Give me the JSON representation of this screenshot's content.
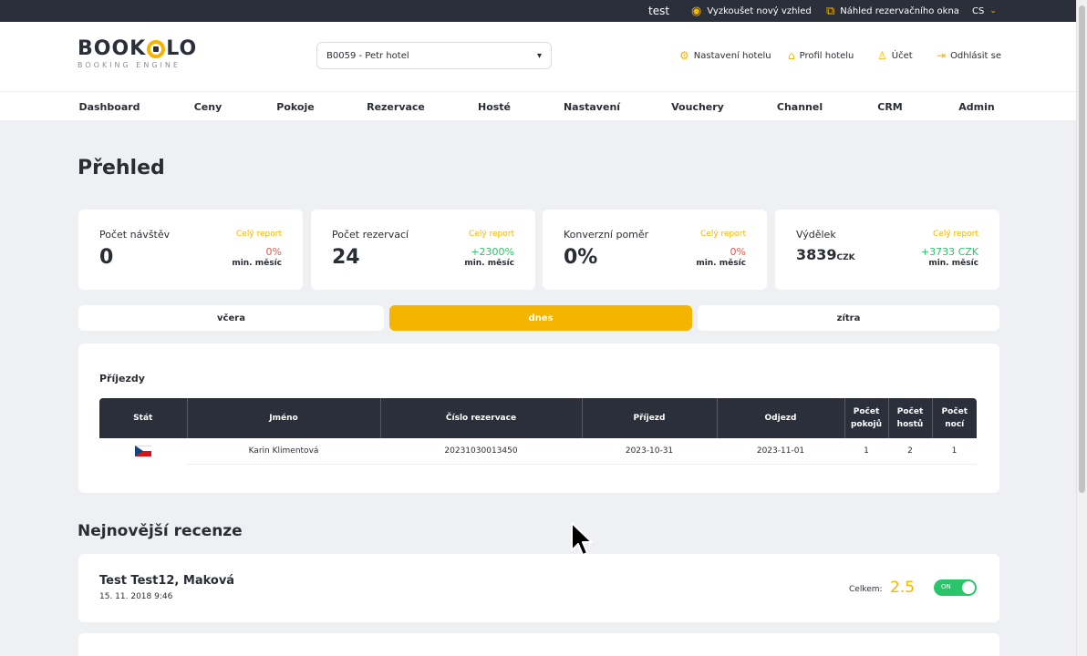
{
  "topbar": {
    "user": "test",
    "try_new_look": "Vyzkoušet nový vzhled",
    "preview_booking": "Náhled rezervačního okna",
    "language": "CS"
  },
  "brand": {
    "name_left": "BOOK",
    "name_right": "LO",
    "tagline": "BOOKING ENGINE"
  },
  "hotel_select": {
    "value": "B0059 - Petr hotel"
  },
  "header_links": {
    "hotel_settings": "Nastavení hotelu",
    "hotel_profile": "Profil hotelu",
    "account": "Účet",
    "logout": "Odhlásit se"
  },
  "nav": [
    "Dashboard",
    "Ceny",
    "Pokoje",
    "Rezervace",
    "Hosté",
    "Nastavení",
    "Vouchery",
    "Channel",
    "CRM",
    "Admin"
  ],
  "page_title": "Přehled",
  "stats": [
    {
      "label": "Počet návštěv",
      "value": "0",
      "unit": "",
      "report": "Celý report",
      "delta": "0%",
      "period": "min. měsíc"
    },
    {
      "label": "Počet rezervací",
      "value": "24",
      "unit": "",
      "report": "Celý report",
      "delta": "+2300%",
      "period": "min. měsíc"
    },
    {
      "label": "Konverzní poměr",
      "value": "0%",
      "unit": "",
      "report": "Celý report",
      "delta": "0%",
      "period": "min. měsíc"
    },
    {
      "label": "Výdělek",
      "value": "3839",
      "unit": "CZK",
      "report": "Celý report",
      "delta": "+3733 CZK",
      "period": "min. měsíc"
    }
  ],
  "day_tabs": {
    "yesterday": "včera",
    "today": "dnes",
    "tomorrow": "zítra",
    "active": "today"
  },
  "arrivals": {
    "title": "Příjezdy",
    "columns": {
      "state": "Stát",
      "name": "Jméno",
      "reservation_no": "Číslo rezervace",
      "arrival": "Příjezd",
      "departure": "Odjezd",
      "rooms": "Počet pokojů",
      "guests": "Počet hostů",
      "nights": "Počet nocí"
    },
    "rows": [
      {
        "country": "CZ",
        "name": "Karin Klimentová",
        "reservation_no": "20231030013450",
        "arrival": "2023-10-31",
        "departure": "2023-11-01",
        "rooms": "1",
        "guests": "2",
        "nights": "1"
      }
    ]
  },
  "reviews": {
    "title": "Nejnovější recenze",
    "items": [
      {
        "name": "Test Test12, Maková",
        "date": "15. 11. 2018 9:46",
        "total_label": "Celkem:",
        "score": "2.5",
        "toggle": "ON"
      }
    ]
  },
  "colors": {
    "accent": "#f5b400",
    "dark": "#2b2f3a",
    "positive": "#2bc46b",
    "negative": "#e05a4a"
  }
}
